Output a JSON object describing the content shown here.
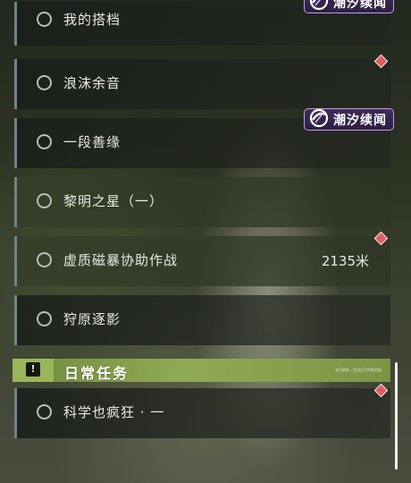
{
  "quests": [
    {
      "title": "我的搭档"
    },
    {
      "title": "浪沫余音"
    },
    {
      "title": "一段善缘"
    },
    {
      "title": "黎明之星（一）"
    },
    {
      "title": "虚质磁暴协助作战",
      "distance": "2135米"
    },
    {
      "title": "狩原逐影"
    }
  ],
  "event_badge": {
    "label": "潮汐续闻",
    "icon": "tide-event-icon",
    "border_color": "#c79ce6"
  },
  "daily_section": {
    "title": "日常任务",
    "icon": "exclamation-icon",
    "note": "每日刷新 · 完成后可领取奖励",
    "accent": "#90aa55",
    "quests": [
      {
        "title": "科学也疯狂 · 一"
      }
    ]
  },
  "marker_color": "#e25a62",
  "icons": {
    "quest_status": "circle-outline-icon",
    "tracked_marker": "diamond-marker-icon"
  }
}
